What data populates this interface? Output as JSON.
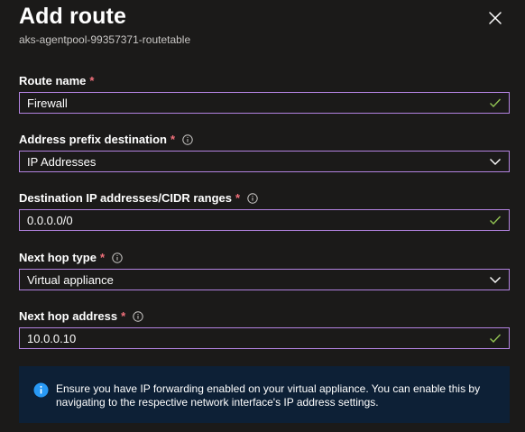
{
  "panel": {
    "title": "Add route",
    "subtitle": "aks-agentpool-99357371-routetable",
    "close_icon": "close-icon"
  },
  "fields": {
    "route_name": {
      "label": "Route name",
      "required": "*",
      "value": "Firewall",
      "state_icon": "checkmark-icon"
    },
    "address_prefix": {
      "label": "Address prefix destination",
      "required": "*",
      "value": "IP Addresses",
      "state_icon": "chevron-down-icon"
    },
    "destination": {
      "label": "Destination IP addresses/CIDR ranges",
      "required": "*",
      "value": "0.0.0.0/0",
      "state_icon": "checkmark-icon"
    },
    "next_hop_type": {
      "label": "Next hop type",
      "required": "*",
      "value": "Virtual appliance",
      "state_icon": "chevron-down-icon"
    },
    "next_hop_address": {
      "label": "Next hop address",
      "required": "*",
      "value": "10.0.0.10",
      "state_icon": "checkmark-icon"
    }
  },
  "notice": {
    "icon": "info-icon",
    "text": "Ensure you have IP forwarding enabled on your virtual appliance. You can enable this by navigating to the respective network interface's IP address settings."
  },
  "colors": {
    "background": "#1b1a19",
    "input_border": "#b383e0",
    "required": "#f1707b",
    "check": "#92c353",
    "notice_bg": "#0d2036",
    "info_blue": "#2899f5"
  }
}
